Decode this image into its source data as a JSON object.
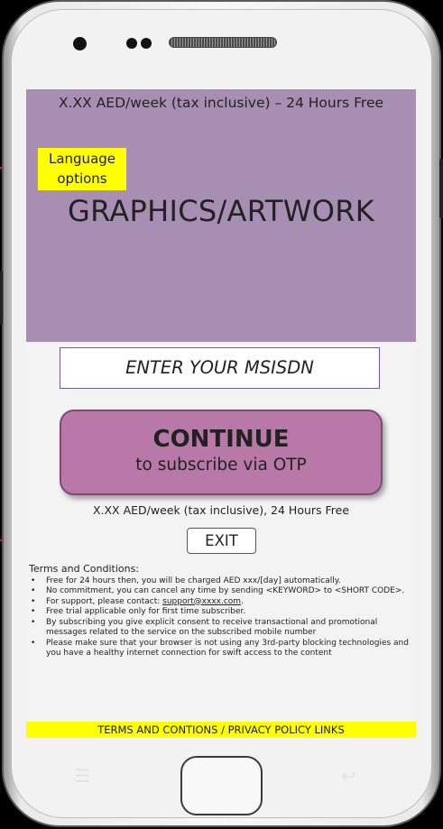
{
  "top_price_text": "X.XX AED/week (tax inclusive) – 24 Hours Free",
  "language_label": "Language options",
  "artwork_placeholder": "GRAPHICS/ARTWORK",
  "msisdn_placeholder": "ENTER YOUR MSISDN",
  "continue_title": "CONTINUE",
  "continue_subtitle": "to subscribe via OTP",
  "bottom_price_text": "X.XX AED/week (tax inclusive), 24 Hours Free",
  "exit_label": "EXIT",
  "terms": {
    "title": "Terms and Conditions:",
    "items": [
      "Free for 24 hours then, you will be charged AED xxx/[day] automatically.",
      "No commitment, you can cancel any time by sending <KEYWORD> to <SHORT CODE>.",
      "For support, please contact: ",
      "Free trial applicable only for first time subscriber.",
      "By subscribing you give explicit consent to receive transactional and promotional messages related to the service on the subscribed mobile number",
      "Please make sure that your browser is not using any 3rd-party blocking technologies and you have a healthy internet connection for swift access to the content"
    ],
    "support_email": "support@xxxx.com"
  },
  "links_bar_text": "TERMS AND CONTIONS / PRIVACY POLICY LINKS",
  "colors": {
    "banner": "#a98eb4",
    "continue_button": "#b878a8",
    "highlight": "#ffff00",
    "arrow": "#ee1111"
  },
  "icons": [
    "camera-icon",
    "speaker-grille-icon",
    "menu-icon",
    "back-icon",
    "home-button"
  ]
}
